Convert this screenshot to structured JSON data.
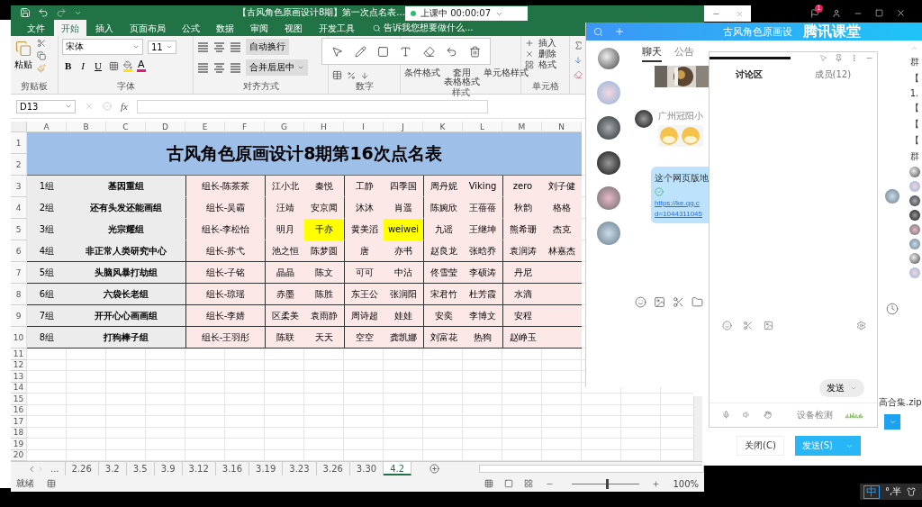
{
  "excel": {
    "title": "【古风角色原画设计8期】第一次点名表...",
    "ribbon_tabs": [
      {
        "label": "文件",
        "selected": false
      },
      {
        "label": "开始",
        "selected": true
      },
      {
        "label": "插入",
        "selected": false
      },
      {
        "label": "页面布局",
        "selected": false
      },
      {
        "label": "公式",
        "selected": false
      },
      {
        "label": "数据",
        "selected": false
      },
      {
        "label": "审阅",
        "selected": false
      },
      {
        "label": "视图",
        "selected": false
      },
      {
        "label": "开发工具",
        "selected": false
      }
    ],
    "tell_me": "告诉我您想要做什么...",
    "ribbon": {
      "paste": "粘贴",
      "font_name": "宋体",
      "font_size": "11",
      "format_buttons": [
        "B",
        "I",
        "U"
      ],
      "font_color": "A",
      "wrap_text": "自动换行",
      "merge_center": "合并后居中",
      "conditional_format": "条件格式",
      "table_format": [
        "套用",
        "表格格式"
      ],
      "cell_styles": "单元格样式",
      "insert": "插入",
      "delete": "删除",
      "format": "格式",
      "group_labels": [
        "剪贴板",
        "字体",
        "对齐方式",
        "数字",
        "样式",
        "单元格"
      ]
    },
    "name_box": "D13",
    "fx": "fx",
    "columns": [
      "A",
      "B",
      "C",
      "D",
      "E",
      "F",
      "G",
      "H",
      "I",
      "J",
      "K",
      "L",
      "M",
      "N"
    ],
    "row_numbers": [
      "1",
      "2",
      "3",
      "4",
      "5",
      "6",
      "7",
      "8",
      "9",
      "10",
      "11",
      "12",
      "13",
      "14",
      "15",
      "16",
      "17",
      "18",
      "19",
      "20"
    ],
    "sheet_title": "古风角色原画设计8期第16次点名表",
    "groups": [
      {
        "team": "1组",
        "name": "基因重组",
        "leader": "组长-陈茶茶",
        "members": [
          {
            "name": "江小北",
            "highlighted": false
          },
          {
            "name": "秦悦",
            "highlighted": false
          },
          {
            "name": "工静",
            "highlighted": false
          },
          {
            "name": "四季国",
            "highlighted": false
          },
          {
            "name": "周丹妮",
            "highlighted": false
          },
          {
            "name": "Viking",
            "highlighted": false
          },
          {
            "name": "zero",
            "highlighted": false
          },
          {
            "name": "刘子健",
            "highlighted": false
          }
        ]
      },
      {
        "team": "2组",
        "name": "还有头发还能画组",
        "leader": "组长-吴霸",
        "members": [
          {
            "name": "汪靖",
            "highlighted": false
          },
          {
            "name": "安京闻",
            "highlighted": false
          },
          {
            "name": "沐沐",
            "highlighted": false
          },
          {
            "name": "肖遥",
            "highlighted": false
          },
          {
            "name": "陈婉欣",
            "highlighted": false
          },
          {
            "name": "王蓓蓓",
            "highlighted": false
          },
          {
            "name": "秋韵",
            "highlighted": false
          },
          {
            "name": "格格",
            "highlighted": false
          }
        ]
      },
      {
        "team": "3组",
        "name": "光宗耀组",
        "leader": "组长-李松怡",
        "members": [
          {
            "name": "明月",
            "highlighted": false
          },
          {
            "name": "千亦",
            "highlighted": true
          },
          {
            "name": "黄美滔",
            "highlighted": false
          },
          {
            "name": "weiwei",
            "highlighted": true
          },
          {
            "name": "九谣",
            "highlighted": false
          },
          {
            "name": "王继坤",
            "highlighted": false
          },
          {
            "name": "熊希珊",
            "highlighted": false
          },
          {
            "name": "杰克",
            "highlighted": false
          }
        ]
      },
      {
        "team": "4组",
        "name": "非正常人类研究中心",
        "leader": "组长-苏弋",
        "members": [
          {
            "name": "池之恒",
            "highlighted": false
          },
          {
            "name": "陈梦圆",
            "highlighted": false
          },
          {
            "name": "唐",
            "highlighted": false
          },
          {
            "name": "亦书",
            "highlighted": false
          },
          {
            "name": "赵良龙",
            "highlighted": false
          },
          {
            "name": "张晗乔",
            "highlighted": false
          },
          {
            "name": "袁润涛",
            "highlighted": false
          },
          {
            "name": "林嘉杰",
            "highlighted": false
          }
        ]
      },
      {
        "team": "5组",
        "name": "头脑风暴打劫组",
        "leader": "组长-子铭",
        "members": [
          {
            "name": "晶晶",
            "highlighted": false
          },
          {
            "name": "陈文",
            "highlighted": false
          },
          {
            "name": "可可",
            "highlighted": false
          },
          {
            "name": "中沾",
            "highlighted": false
          },
          {
            "name": "佟雪莹",
            "highlighted": false
          },
          {
            "name": "李硕涛",
            "highlighted": false
          },
          {
            "name": "丹尼",
            "highlighted": false
          }
        ]
      },
      {
        "team": "6组",
        "name": "六袋长老组",
        "leader": "组长-琼瑶",
        "members": [
          {
            "name": "赤墨",
            "highlighted": false
          },
          {
            "name": "陈胜",
            "highlighted": false
          },
          {
            "name": "东王公",
            "highlighted": false
          },
          {
            "name": "张润阳",
            "highlighted": false
          },
          {
            "name": "宋君竹",
            "highlighted": false
          },
          {
            "name": "杜芳霞",
            "highlighted": false
          },
          {
            "name": "水滴",
            "highlighted": false
          }
        ]
      },
      {
        "team": "7组",
        "name": "开开心心画画组",
        "leader": "组长-李婧",
        "members": [
          {
            "name": "区柔美",
            "highlighted": false
          },
          {
            "name": "袁雨静",
            "highlighted": false
          },
          {
            "name": "周诗超",
            "highlighted": false
          },
          {
            "name": "娃娃",
            "highlighted": false
          },
          {
            "name": "安奕",
            "highlighted": false
          },
          {
            "name": "李博文",
            "highlighted": false
          },
          {
            "name": "安程",
            "highlighted": false
          }
        ]
      },
      {
        "team": "8组",
        "name": "打狗棒子组",
        "leader": "组长-王羽彤",
        "members": [
          {
            "name": "陈联",
            "highlighted": false
          },
          {
            "name": "天天",
            "highlighted": false
          },
          {
            "name": "空空",
            "highlighted": false
          },
          {
            "name": "龚凯娜",
            "highlighted": false
          },
          {
            "name": "刘富花",
            "highlighted": false
          },
          {
            "name": "热狗",
            "highlighted": false
          },
          {
            "name": "赵峥玉",
            "highlighted": false
          }
        ]
      }
    ],
    "sheet_more": "...",
    "sheet_tabs": [
      {
        "label": "2.26",
        "selected": false
      },
      {
        "label": "3.2",
        "selected": false
      },
      {
        "label": "3.5",
        "selected": false
      },
      {
        "label": "3.9",
        "selected": false
      },
      {
        "label": "3.12",
        "selected": false
      },
      {
        "label": "3.16",
        "selected": false
      },
      {
        "label": "3.19",
        "selected": false
      },
      {
        "label": "3.23",
        "selected": false
      },
      {
        "label": "3.26",
        "selected": false
      },
      {
        "label": "3.30",
        "selected": false
      },
      {
        "label": "4.2",
        "selected": true
      }
    ],
    "status": "就绪",
    "zoom": {
      "label": "100%",
      "level": 0.5
    }
  },
  "recording": {
    "label": "上课中 00:00:07"
  },
  "notifications": {
    "count": "1"
  },
  "chat": {
    "title": "古风角色原画设",
    "brand": "腾讯课堂",
    "tabs": [
      {
        "label": "聊天",
        "selected": true
      },
      {
        "label": "公告",
        "selected": false
      }
    ],
    "sender": "广州冠阳小",
    "bubble_text": "这个网页版地",
    "link_lines": [
      "https://ke.qq.c",
      "d=1044311045"
    ],
    "side_texts": [
      "群",
      "【",
      "1.",
      "【",
      "【",
      "【",
      "群"
    ]
  },
  "discussion": {
    "tabs": [
      {
        "label": "讨论区",
        "selected": true
      },
      {
        "label": "成员(12)",
        "selected": false
      }
    ],
    "send": "发送",
    "device_check": "设备检测"
  },
  "back_window": {
    "file": "高合集.zip",
    "close": "关闭(C)",
    "send": "发送(S)"
  },
  "ime": {
    "mode": "中",
    "extra": "°,半"
  }
}
